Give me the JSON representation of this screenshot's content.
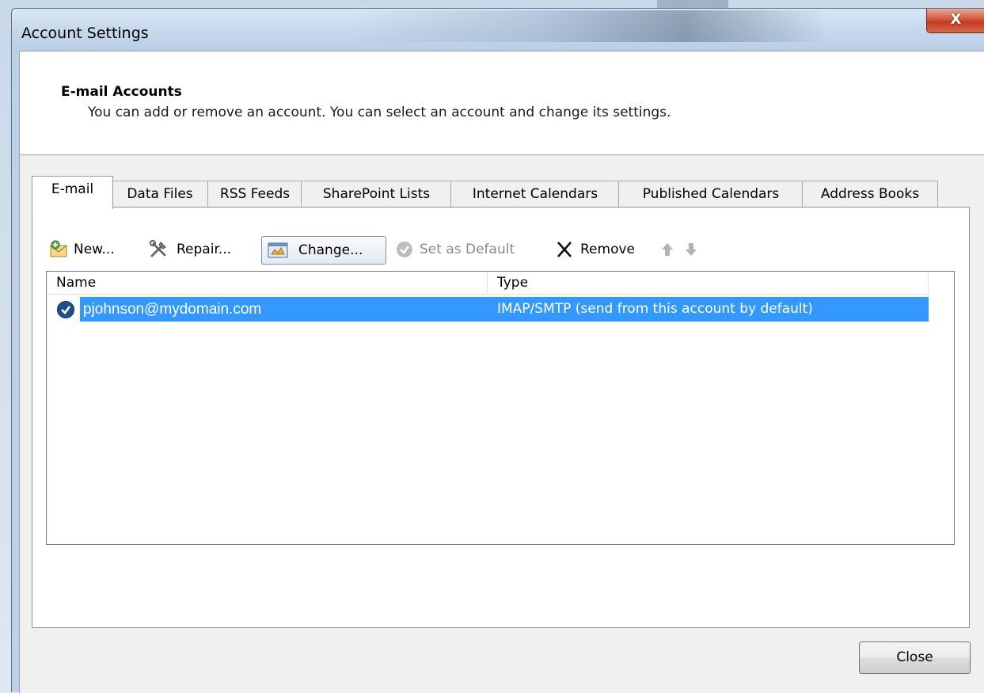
{
  "window": {
    "title": "Account Settings",
    "close_glyph": "X"
  },
  "header": {
    "title": "E-mail Accounts",
    "subtitle": "You can add or remove an account. You can select an account and change its settings."
  },
  "tabs": [
    {
      "label": "E-mail",
      "active": true
    },
    {
      "label": "Data Files"
    },
    {
      "label": "RSS Feeds"
    },
    {
      "label": "SharePoint Lists"
    },
    {
      "label": "Internet Calendars"
    },
    {
      "label": "Published Calendars"
    },
    {
      "label": "Address Books"
    }
  ],
  "toolbar": {
    "new_label": "New...",
    "repair_label": "Repair...",
    "change_label": "Change...",
    "set_default_label": "Set as Default",
    "remove_label": "Remove",
    "icons": [
      "new-account-icon",
      "repair-icon",
      "change-icon",
      "set-default-icon",
      "remove-icon",
      "move-up-icon",
      "move-down-icon"
    ]
  },
  "list": {
    "columns": [
      "Name",
      "Type"
    ],
    "rows": [
      {
        "name": "pjohnson@mydomain.com",
        "type": "IMAP/SMTP (send from this account by default)",
        "selected": true
      }
    ]
  },
  "footer": {
    "close_label": "Close"
  },
  "colors": {
    "selection": "#3399ff",
    "close_button_red": "#c23b21",
    "default_check": "#1f4f8a"
  }
}
